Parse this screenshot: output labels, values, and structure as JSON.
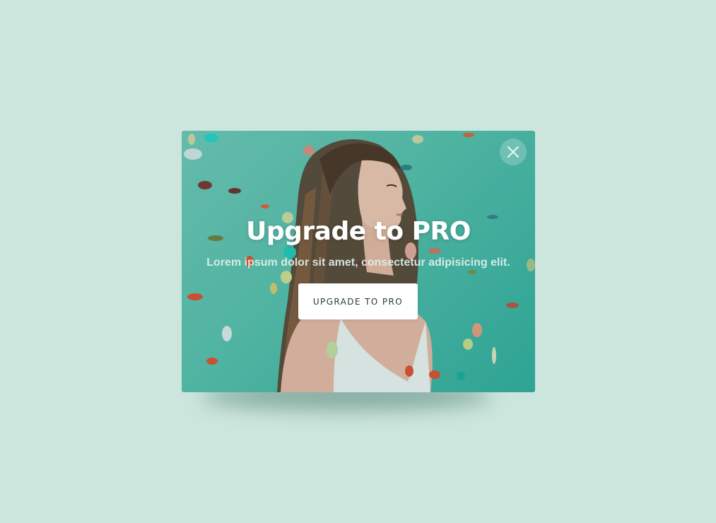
{
  "modal": {
    "title": "Upgrade to PRO",
    "subtitle": "Lorem ipsum dolor sit amet, consectetur adipisicing elit.",
    "cta_label": "UPGRADE TO PRO",
    "close_icon": "close-icon"
  },
  "colors": {
    "page_background": "#cce6dd",
    "modal_teal": "#55bba9",
    "button_background": "#ffffff",
    "button_text": "#2b3a3d"
  }
}
